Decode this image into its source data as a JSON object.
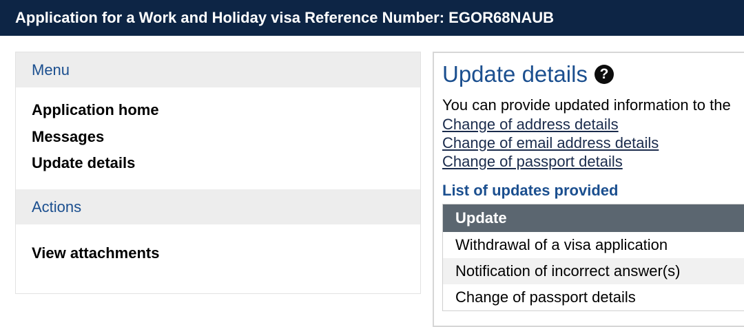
{
  "header": {
    "title": "Application for a Work and Holiday visa Reference Number: EGOR68NAUB"
  },
  "sidebar": {
    "menu_heading": "Menu",
    "menu_items": [
      {
        "label": "Application home"
      },
      {
        "label": "Messages"
      },
      {
        "label": "Update details"
      }
    ],
    "actions_heading": "Actions",
    "action_items": [
      {
        "label": "View attachments"
      }
    ]
  },
  "main": {
    "title": "Update details",
    "help_icon": "?",
    "intro": "You can provide updated information to the",
    "links": [
      {
        "label": "Change of address details"
      },
      {
        "label": "Change of email address details"
      },
      {
        "label": "Change of passport details"
      }
    ],
    "updates_heading": "List of updates provided",
    "table": {
      "column_header": "Update",
      "rows": [
        {
          "update": "Withdrawal of a visa application"
        },
        {
          "update": "Notification of incorrect answer(s)"
        },
        {
          "update": "Change of passport details"
        }
      ]
    }
  },
  "colors": {
    "header_bg": "#0d2545",
    "accent_blue": "#1b4f8f",
    "table_header_bg": "#5b6670"
  }
}
